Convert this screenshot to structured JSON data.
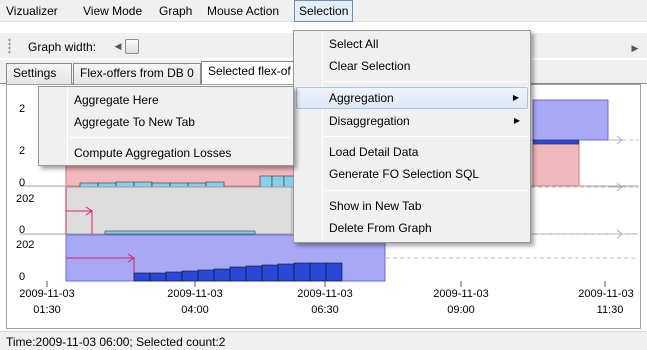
{
  "menubar": {
    "items": [
      "Vizualizer",
      "View Mode",
      "Graph",
      "Mouse Action",
      "Selection"
    ]
  },
  "toolbar": {
    "graph_width_label": "Graph width:",
    "left_arrow": "◀",
    "right_arrow": "▶"
  },
  "tabs": [
    "Settings",
    "Flex-offers from DB 0",
    "Selected flex-of"
  ],
  "selection_menu": {
    "items": [
      "Select All",
      "Clear Selection",
      "Aggregation",
      "Disaggregation",
      "Load Detail Data",
      "Generate FO Selection SQL",
      "Show in New Tab",
      "Delete From Graph"
    ]
  },
  "aggregation_submenu": {
    "items": [
      "Aggregate Here",
      "Aggregate To New Tab",
      "Compute Aggregation Losses"
    ]
  },
  "chart": {
    "y_labels": [
      "2",
      "2",
      "0",
      "202",
      "0",
      "202",
      "0"
    ],
    "x_ticks": [
      {
        "date": "2009-11-03",
        "time": "01:30"
      },
      {
        "date": "2009-11-03",
        "time": "04:00"
      },
      {
        "date": "2009-11-03",
        "time": "06:30"
      },
      {
        "date": "2009-11-03",
        "time": "09:00"
      },
      {
        "date": "2009-11-03",
        "time": "11:30"
      }
    ],
    "colors": {
      "pink_area": "#f2b8bc",
      "blue_area": "#a8a8f4",
      "gray_area": "#dcdcdc",
      "bar_fill": "#87cfeb",
      "bar_fill_dark": "#2a48d8",
      "marker": "#e0206a"
    }
  },
  "status": {
    "text": "Time:2009-11-03 06:00; Selected count:2"
  }
}
